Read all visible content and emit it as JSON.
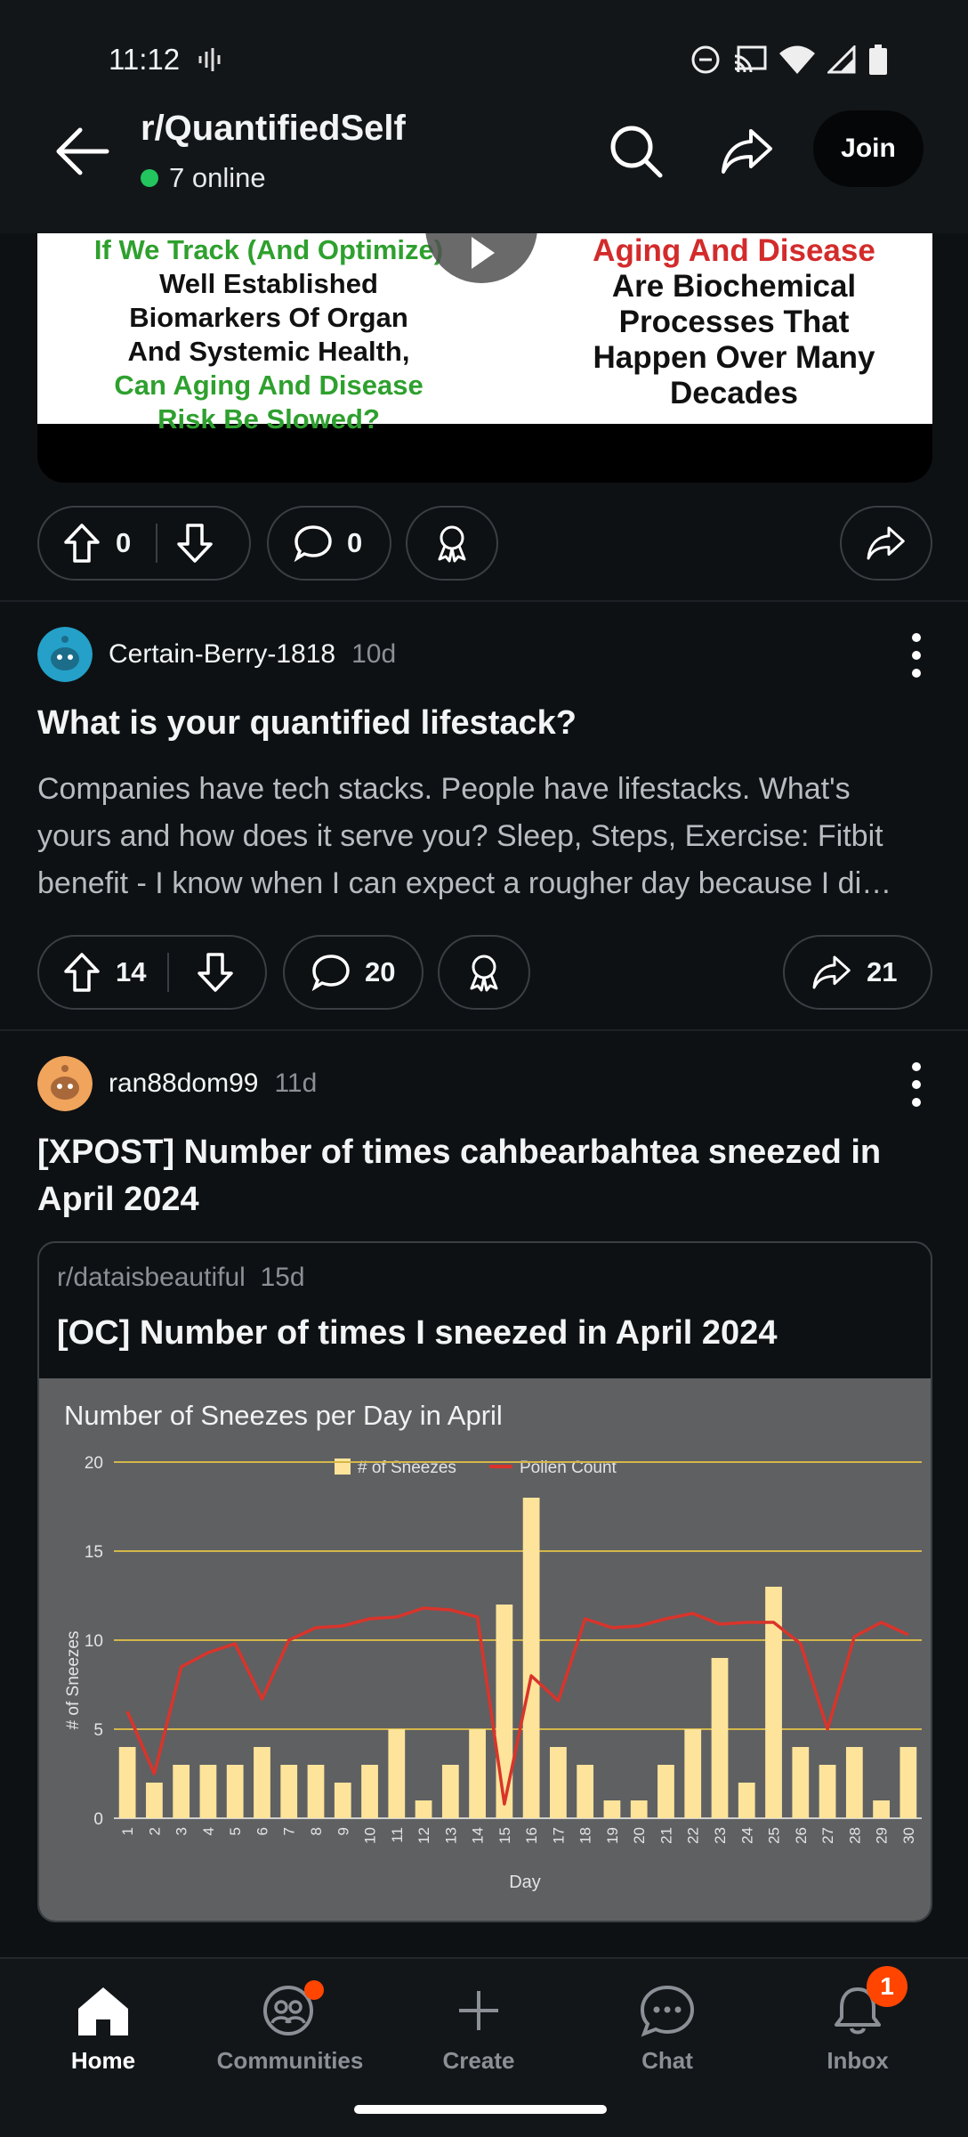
{
  "status_bar": {
    "time": "11:12"
  },
  "header": {
    "subreddit": "r/QuantifiedSelf",
    "online": "7 online",
    "join_label": "Join"
  },
  "video_post": {
    "thumbnail_left": [
      "If We Track (And Optimize)",
      "Well Established",
      "Biomarkers Of Organ",
      "And Systemic Health,",
      "Can Aging And Disease",
      "Risk Be Slowed?"
    ],
    "thumbnail_right": [
      "Aging And Disease",
      "Are Biochemical",
      "Processes That",
      "Happen Over Many",
      "Decades"
    ],
    "upvotes": "0",
    "comments": "0"
  },
  "post1": {
    "author": "Certain-Berry-1818",
    "age": "10d",
    "title": "What is your quantified lifestack?",
    "body": "Companies have tech stacks. People have lifestacks. What's yours and how does it serve you? Sleep, Steps, Exercise: Fitbit benefit - I know when I can expect a rougher day because I di…",
    "upvotes": "14",
    "comments": "20",
    "shares": "21"
  },
  "post2": {
    "author": "ran88dom99",
    "age": "11d",
    "title": "[XPOST] Number of times cahbearbahtea sneezed in April 2024",
    "crosspost": {
      "subreddit": "r/dataisbeautiful",
      "age": "15d",
      "title": "[OC] Number of times I sneezed in April 2024"
    }
  },
  "chart_data": {
    "type": "bar",
    "title": "Number of Sneezes per Day in April",
    "xlabel": "Day",
    "ylabel": "# of Sneezes",
    "ylim": [
      0,
      20
    ],
    "yticks": [
      0,
      5,
      10,
      15,
      20
    ],
    "legend_position": "top-center",
    "categories": [
      "1",
      "2",
      "3",
      "4",
      "5",
      "6",
      "7",
      "8",
      "9",
      "10",
      "11",
      "12",
      "13",
      "14",
      "15",
      "16",
      "17",
      "18",
      "19",
      "20",
      "21",
      "22",
      "23",
      "24",
      "25",
      "26",
      "27",
      "28",
      "29",
      "30"
    ],
    "series": [
      {
        "name": "# of Sneezes",
        "type": "bar",
        "color": "#fde49a",
        "values": [
          4,
          2,
          3,
          3,
          3,
          4,
          3,
          3,
          2,
          3,
          5,
          1,
          3,
          5,
          12,
          18,
          4,
          3,
          1,
          1,
          3,
          5,
          9,
          2,
          13,
          4,
          3,
          4,
          1,
          4
        ]
      },
      {
        "name": "Pollen Count",
        "type": "line",
        "color": "#d9342b",
        "values": [
          6,
          2.5,
          8.5,
          9.3,
          9.8,
          6.7,
          10,
          10.7,
          10.8,
          11.2,
          11.3,
          11.8,
          11.7,
          11.3,
          0.8,
          8,
          6.6,
          11.2,
          10.7,
          10.8,
          11.2,
          11.5,
          10.9,
          11,
          11,
          9.8,
          5,
          10.2,
          11,
          10.3
        ]
      }
    ],
    "grid": true
  },
  "nav": {
    "items": [
      {
        "label": "Home"
      },
      {
        "label": "Communities"
      },
      {
        "label": "Create"
      },
      {
        "label": "Chat"
      },
      {
        "label": "Inbox",
        "badge": "1"
      }
    ]
  },
  "colors": {
    "accent": "#ff4500",
    "online": "#22c55e",
    "background": "#0e1113"
  }
}
